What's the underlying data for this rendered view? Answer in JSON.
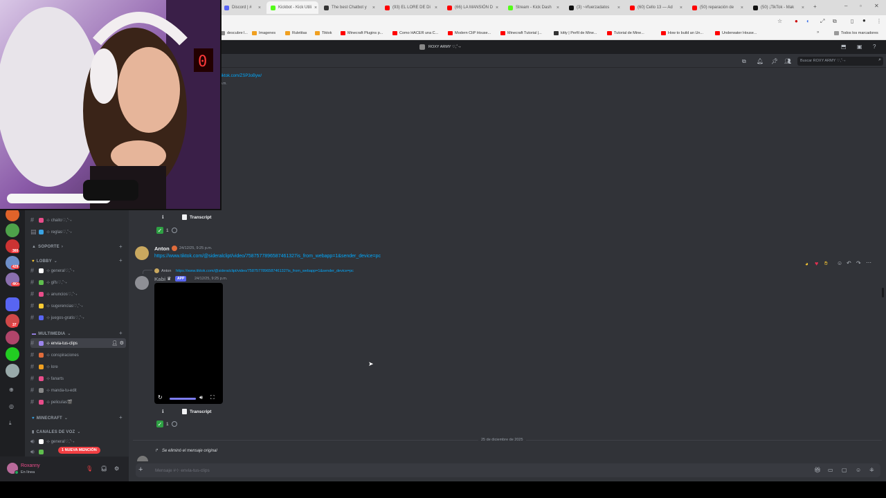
{
  "browser": {
    "tabs": [
      {
        "title": "Discord | #",
        "active": false,
        "color": "#5865f2"
      },
      {
        "title": "Kickbot - Kick Utili",
        "active": true,
        "color": "#53fc18"
      },
      {
        "title": "The best Chatbot y",
        "active": false,
        "color": "#333333"
      },
      {
        "title": "(93) EL LORE DE Di",
        "active": false,
        "color": "#ff0000"
      },
      {
        "title": "(66) LA MANSIÓN D",
        "active": false,
        "color": "#ff0000"
      },
      {
        "title": "Stream - Kick Dash",
        "active": false,
        "color": "#53fc18"
      },
      {
        "title": "(3) ~#fuerzadatos",
        "active": false,
        "color": "#111111"
      },
      {
        "title": "(60) Cello 13 — Ad",
        "active": false,
        "color": "#ff0000"
      },
      {
        "title": "(50) reparación de",
        "active": false,
        "color": "#ff0000"
      },
      {
        "title": "(50) ¡TikTok - Mak",
        "active": false,
        "color": "#111111"
      }
    ],
    "bookmarks": [
      {
        "label": "descubre l...",
        "color": "#888888"
      },
      {
        "label": "Imagenes",
        "color": "#f0a020"
      },
      {
        "label": "Ruletitas",
        "color": "#f0a020"
      },
      {
        "label": "Tiktok",
        "color": "#f0a020"
      },
      {
        "label": "Minecraft Plugins p...",
        "color": "#ff0000"
      },
      {
        "label": "Como HACER una C...",
        "color": "#ff0000"
      },
      {
        "label": "Modern CliP House...",
        "color": "#ff0000"
      },
      {
        "label": "Minecraft Tutorial |...",
        "color": "#ff0000"
      },
      {
        "label": "kitty | Perfil de Mine...",
        "color": "#333333"
      },
      {
        "label": "Tutorial de Mine...",
        "color": "#ff0000"
      },
      {
        "label": "How to build an Un...",
        "color": "#ff0000"
      },
      {
        "label": "Underwater House...",
        "color": "#ff0000"
      }
    ],
    "all_bookmarks_label": "Todos los marcadores"
  },
  "discord": {
    "server_title": "ROXY ARMY ♡,˚‧₊",
    "search_placeholder": "Buscar ROXY ARMY ♡,˚‧₊",
    "guild_badges": [
      "360",
      "429",
      "4K+",
      "37"
    ],
    "channels": {
      "top": [
        {
          "label": "⊹ chaito♡,˚‧₊",
          "emoji_color": "#e84d8a"
        },
        {
          "label": "⊹ reglas♡,˚‧₊",
          "emoji_color": "#3aa3e3"
        }
      ],
      "soporte_label": "SOPORTE",
      "lobby_label": "LOBBY",
      "lobby": [
        {
          "label": "⊹ general♡,˚‧₊",
          "emoji_color": "#ffffff"
        },
        {
          "label": "⊹ gifs♡,˚‧₊",
          "emoji_color": "#5fbf4e"
        },
        {
          "label": "⊹ anuncios♡,˚‧₊",
          "emoji_color": "#e84d8a"
        },
        {
          "label": "⊹ sugerencias♡,˚‧₊",
          "emoji_color": "#ffcc33"
        },
        {
          "label": "⊹ juegos-gratis♡,˚‧₊",
          "emoji_color": "#5865f2"
        }
      ],
      "multimedia_label": "MULTIMEDIA",
      "multimedia": [
        {
          "label": "⊹ envia-tus-clips",
          "emoji_color": "#9b84ec",
          "active": true
        },
        {
          "label": "⊹ conspiraciones",
          "emoji_color": "#e06c3b"
        },
        {
          "label": "⊹ lore",
          "emoji_color": "#f0a020"
        },
        {
          "label": "⊹ fanarts",
          "emoji_color": "#e84d8a"
        },
        {
          "label": "⊹ manda-tu-edit",
          "emoji_color": "#888888"
        },
        {
          "label": "⊹ peliculas🎬",
          "emoji_color": "#e84d8a"
        }
      ],
      "minecraft_label": "MINECRAFT",
      "voz_label": "CANALES DE VOZ",
      "voz": [
        {
          "label": "⊹ general♡,˚‧₊"
        }
      ]
    },
    "new_mention_label": "1 NUEVA MENCIÓN",
    "user": {
      "name": "Roxanny",
      "status": "En línea"
    },
    "messages": {
      "top_link": "tiktok.com/ZSP3oByw/",
      "top_time": "p.m.",
      "transcript_label": "Transcript",
      "reaction_count_1": "1",
      "msg1": {
        "author": "Anton",
        "time": "24/12/25, 9:25 p.m.",
        "link": "https://www.tiktok.com/@sideralclipt/video/7587577896587461327is_from_webapp=1&sender_device=pc"
      },
      "msg2": {
        "reply_author": "Anton",
        "reply_link": "https://www.tiktok.com/@sideralclipt/video/7587577896587461327is_from_webapp=1&sender_device=pc",
        "author": "Kabi",
        "app_badge": "APP",
        "time": "24/12/25, 9:25 p.m."
      },
      "reaction_count_2": "1",
      "date_divider": "25 de diciembre de 2025",
      "deleted_note": "Se eliminó el mensaje original",
      "composer_placeholder": "Mensaje #⊹ envia-tus-clips"
    }
  }
}
